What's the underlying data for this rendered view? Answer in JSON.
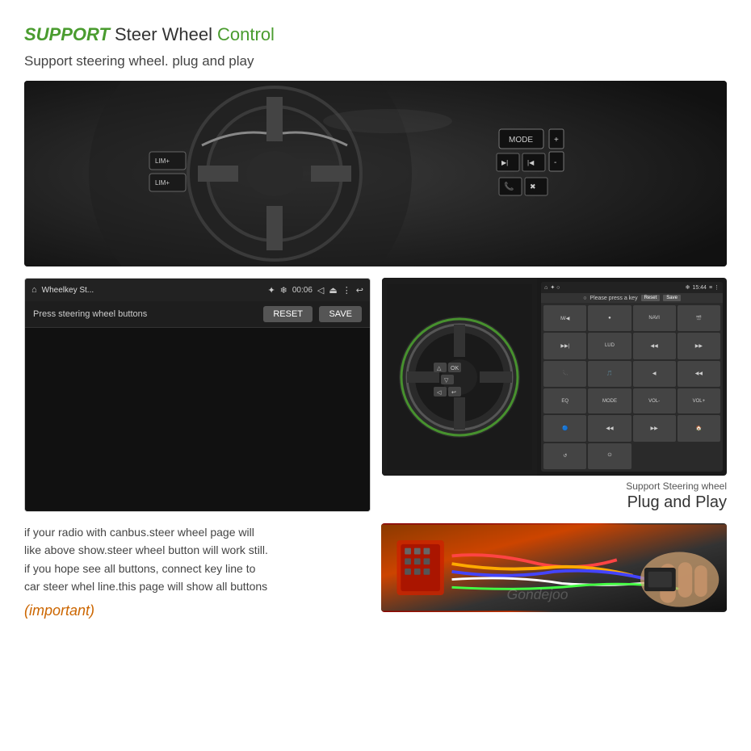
{
  "page": {
    "background": "#ffffff"
  },
  "header": {
    "title_support": "SUPPORT",
    "title_steer": " Steer Wheel ",
    "title_control": "Control",
    "subtitle": "Support steering wheel. plug and play"
  },
  "left_panel": {
    "app_name": "Wheelkey St...",
    "time": "00:06",
    "press_text": "Press steering wheel buttons",
    "reset_label": "RESET",
    "save_label": "SAVE"
  },
  "right_panel": {
    "status_time": "15:44",
    "please_text": "Please press a key",
    "reset_label": "Reset",
    "save_label": "Save",
    "grid_buttons": [
      "M/▶",
      "●",
      "NAVI",
      "🎬",
      "▶▶|",
      "LUD",
      "◀◀",
      "▶▶",
      "📞",
      "🎵",
      "◀",
      "◀◀",
      "EQ",
      "MODE",
      "VOL-",
      "VOL+",
      "🔵",
      "◀◀",
      "▶▶",
      "🏠",
      "↺",
      "⏻"
    ]
  },
  "labels": {
    "support_steering": "Support Steering wheel",
    "plug_play": "Plug and Play"
  },
  "bottom_text": {
    "line1": "if your radio with canbus.steer wheel page will",
    "line2": "like above show.steer wheel button will work still.",
    "line3": "if you hope see all buttons, connect key line to",
    "line4": "car steer whel line.this page will show all buttons",
    "important": "(important)"
  },
  "watermark": "Gondejoo"
}
